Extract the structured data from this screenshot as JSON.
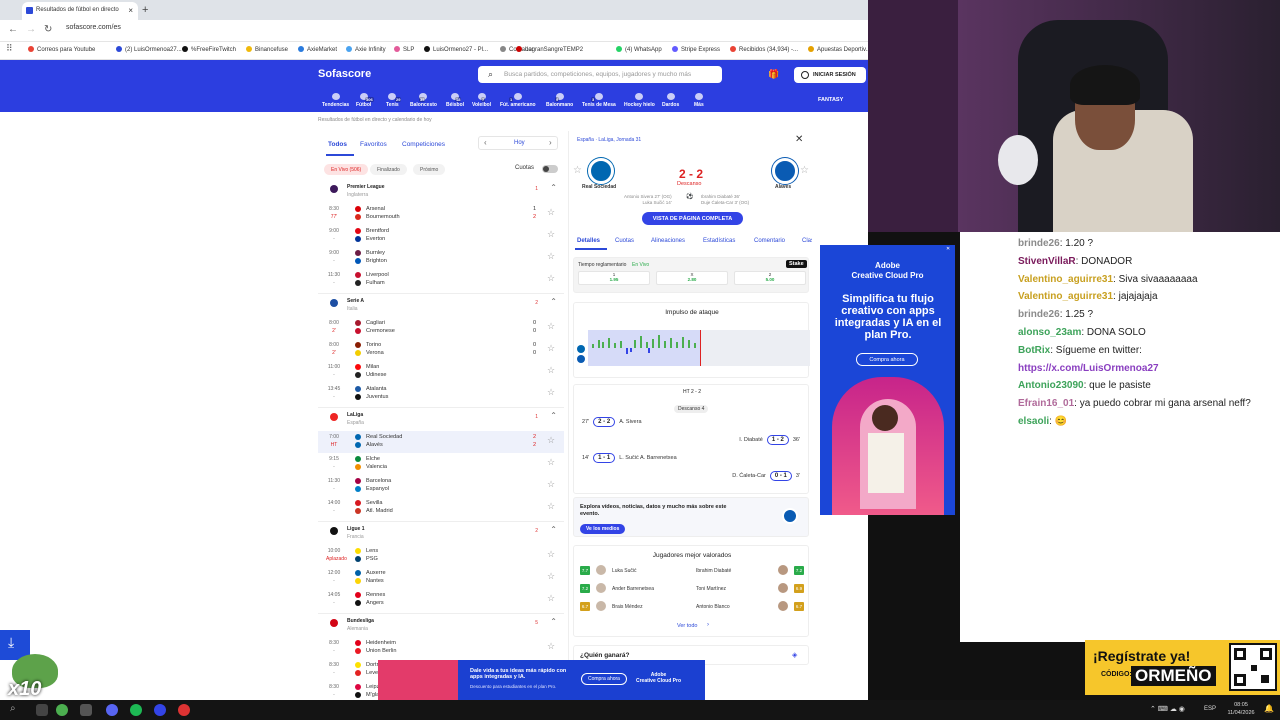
{
  "browser": {
    "tab_title": "Resultados de fútbol en directo",
    "tab_close": "×",
    "new_tab": "+",
    "url": "sofascore.com/es",
    "bookmarks": [
      {
        "label": "Correos para Youtube",
        "color": "#ea4335"
      },
      {
        "label": "(2) LuisOrmenoa27...",
        "color": "#2c49d8"
      },
      {
        "label": "%FreeFireTwitch",
        "color": "#111"
      },
      {
        "label": "Binancefuse",
        "color": "#f0b90b"
      },
      {
        "label": "AxieMarket",
        "color": "#2a7bde"
      },
      {
        "label": "Axie Infinity",
        "color": "#4aa3f0"
      },
      {
        "label": "SLP",
        "color": "#e35b9a"
      },
      {
        "label": "LuisOrmeno27 - Pl...",
        "color": "#111"
      },
      {
        "label": "Contador",
        "color": "#888"
      },
      {
        "label": "LagranSangreTEMP2",
        "color": "#c00"
      },
      {
        "label": "(4) WhatsApp",
        "color": "#25d366"
      },
      {
        "label": "Stripe Express",
        "color": "#635bff"
      },
      {
        "label": "Recibidos (34,934) -...",
        "color": "#ea4335"
      },
      {
        "label": "Apuestas Deportiv...",
        "color": "#e5a100"
      }
    ]
  },
  "sofascore": {
    "logo": "Sofascore",
    "search_placeholder": "Busca partidos, competiciones, equipos, jugadores y mucho más",
    "login": "INICIAR SESIÓN",
    "fantasy": "FANTASY",
    "sports": [
      {
        "label": "Tendencias"
      },
      {
        "label": "Fútbol",
        "badge": "306"
      },
      {
        "label": "Tenis",
        "badge": "29"
      },
      {
        "label": "Baloncesto",
        "badge": "35"
      },
      {
        "label": "Béisbol",
        "badge": "18"
      },
      {
        "label": "Voleibol",
        "badge": "7"
      },
      {
        "label": "Fút. americano",
        "badge": "1"
      },
      {
        "label": "Balonmano",
        "badge": "9"
      },
      {
        "label": "Tenis de Mesa",
        "badge": "3"
      },
      {
        "label": "Hockey hielo"
      },
      {
        "label": "Dardos"
      },
      {
        "label": "Más"
      }
    ],
    "breadcrumb": "Resultados de fútbol en directo y calendario de hoy",
    "left": {
      "tabs": [
        "Todos",
        "Favoritos",
        "Competiciones"
      ],
      "day": "Hoy",
      "filters": [
        "En Vivo (506)",
        "Finalizado",
        "Próximo"
      ],
      "odds_label": "Cuotas",
      "leagues": [
        {
          "name": "Premier League",
          "country": "Inglaterra",
          "count": "1",
          "color": "#3d195b",
          "matches": [
            {
              "time": "8:30",
              "min": "77'",
              "home": "Arsenal",
              "away": "Bournemouth",
              "hs": "1",
              "as": "2",
              "hc": "#db0007",
              "ac": "#da291c"
            },
            {
              "time": "9:00",
              "min": "-",
              "home": "Brentford",
              "away": "Everton",
              "hs": "",
              "as": "",
              "hc": "#e30613",
              "ac": "#003399"
            },
            {
              "time": "9:00",
              "min": "-",
              "home": "Burnley",
              "away": "Brighton",
              "hs": "",
              "as": "",
              "hc": "#6c1d45",
              "ac": "#0057b8"
            },
            {
              "time": "11:30",
              "min": "-",
              "home": "Liverpool",
              "away": "Fulham",
              "hs": "",
              "as": "",
              "hc": "#c8102e",
              "ac": "#222"
            }
          ]
        },
        {
          "name": "Serie A",
          "country": "Italia",
          "count": "2",
          "color": "#1c4ea3",
          "matches": [
            {
              "time": "8:00",
              "min": "2'",
              "home": "Cagliari",
              "away": "Cremonese",
              "hs": "0",
              "as": "0",
              "hc": "#a6192e",
              "ac": "#c8102e"
            },
            {
              "time": "8:00",
              "min": "2'",
              "home": "Torino",
              "away": "Verona",
              "hs": "0",
              "as": "0",
              "hc": "#8a1e03",
              "ac": "#f3cd00"
            },
            {
              "time": "11:00",
              "min": "-",
              "home": "Milan",
              "away": "Udinese",
              "hs": "",
              "as": "",
              "hc": "#fb090b",
              "ac": "#222"
            },
            {
              "time": "13:45",
              "min": "-",
              "home": "Atalanta",
              "away": "Juventus",
              "hs": "",
              "as": "",
              "hc": "#1c5aa6",
              "ac": "#111"
            }
          ]
        },
        {
          "name": "LaLiga",
          "country": "España",
          "count": "1",
          "color": "#ee2523",
          "matches": [
            {
              "time": "7:00",
              "min": "HT",
              "home": "Real Sociedad",
              "away": "Alavés",
              "hs": "2",
              "as": "2",
              "hc": "#0067b1",
              "ac": "#0067b1",
              "sel": true
            },
            {
              "time": "9:15",
              "min": "-",
              "home": "Elche",
              "away": "Valencia",
              "hs": "",
              "as": "",
              "hc": "#0a8a3c",
              "ac": "#f18e00"
            },
            {
              "time": "11:30",
              "min": "-",
              "home": "Barcelona",
              "away": "Espanyol",
              "hs": "",
              "as": "",
              "hc": "#a50044",
              "ac": "#007fc8"
            },
            {
              "time": "14:00",
              "min": "-",
              "home": "Sevilla",
              "away": "Atl. Madrid",
              "hs": "",
              "as": "",
              "hc": "#d71920",
              "ac": "#cb3524"
            }
          ]
        },
        {
          "name": "Ligue 1",
          "country": "Francia",
          "count": "2",
          "color": "#111",
          "matches": [
            {
              "time": "10:00",
              "min": "Aplazado",
              "home": "Lens",
              "away": "PSG",
              "hs": "",
              "as": "",
              "hc": "#fddd00",
              "ac": "#004170"
            },
            {
              "time": "12:00",
              "min": "-",
              "home": "Auxerre",
              "away": "Nantes",
              "hs": "",
              "as": "",
              "hc": "#0061a8",
              "ac": "#fcd405"
            },
            {
              "time": "14:05",
              "min": "-",
              "home": "Rennes",
              "away": "Angers",
              "hs": "",
              "as": "",
              "hc": "#e2001a",
              "ac": "#111"
            }
          ]
        },
        {
          "name": "Bundesliga",
          "country": "Alemania",
          "count": "5",
          "color": "#d20515",
          "matches": [
            {
              "time": "8:30",
              "min": "-",
              "home": "Heidenheim",
              "away": "Union Berlin",
              "hs": "",
              "as": "",
              "hc": "#e2001a",
              "ac": "#eb1923"
            },
            {
              "time": "8:30",
              "min": "-",
              "home": "Dortmund",
              "away": "Leverkusen",
              "hs": "",
              "as": "",
              "hc": "#fde100",
              "ac": "#e32221"
            },
            {
              "time": "8:30",
              "min": "-",
              "home": "Leipzig",
              "away": "M'gladbach",
              "hs": "",
              "as": "",
              "hc": "#dd0741",
              "ac": "#111"
            }
          ]
        }
      ]
    },
    "right": {
      "breadcrumb": "España · LaLiga, Jornada 31",
      "home": "Real Sociedad",
      "away": "Alavés",
      "score": "2 - 2",
      "status": "Descanso",
      "home_scorers": "Antonio Sivera 27' (OG)\nLuka Sučić 14'",
      "away_scorers": "Ibrahim Diabaté 36'\nDuje Ćaleta-Car 3' (OG)",
      "full_page_btn": "VISTA DE PÁGINA COMPLETA",
      "tabs": [
        "Detalles",
        "Cuotas",
        "Alineaciones",
        "Estadísticas",
        "Comentario",
        "Clas"
      ],
      "odds_label": "Tiempo reglamentario",
      "odds_live": "En Vivo",
      "odds_brand": "Stake",
      "odds": [
        {
          "k": "1",
          "v": "1.95"
        },
        {
          "k": "X",
          "v": "2.80"
        },
        {
          "k": "2",
          "v": "5.00"
        }
      ],
      "momentum_title": "Impulso de ataque",
      "ht_label": "HT 2 - 2",
      "descanso_label": "Descanso 4",
      "events": [
        {
          "min": "27'",
          "score": "2 - 2",
          "player": "A. Sivera",
          "side": "left"
        },
        {
          "min": "36'",
          "score": "1 - 2",
          "player": "I. Diabaté",
          "side": "right"
        },
        {
          "min": "14'",
          "score": "1 - 1",
          "player": "L. Sučić  A. Barrenetxea",
          "side": "left"
        },
        {
          "min": "3'",
          "score": "0 - 1",
          "player": "D. Ćaleta-Car",
          "side": "right"
        }
      ],
      "explore_text": "Explora vídeos, noticias, datos y mucho más sobre este evento.",
      "media_btn": "Ve los medios",
      "top_players_title": "Jugadores mejor valorados",
      "top_players": [
        {
          "left": "Luka Sučić",
          "lr": "7.7",
          "lc": "#2aab4a",
          "right": "Ibrahim Diabaté",
          "rr": "7.2",
          "rc": "#2aab4a"
        },
        {
          "left": "Ander Barrenetxea",
          "lr": "7.2",
          "lc": "#2aab4a",
          "right": "Toni Martínez",
          "rr": "6.9",
          "rc": "#d3a01c"
        },
        {
          "left": "Brais Méndez",
          "lr": "6.7",
          "lc": "#d3a01c",
          "right": "Antonio Blanco",
          "rr": "6.7",
          "rc": "#d3a01c"
        }
      ],
      "see_all": "Ver todo",
      "who_wins": "¿Quién ganará?"
    }
  },
  "side_ad": {
    "brand": "Adobe\nCreative Cloud Pro",
    "headline": "Simplifica tu flujo creativo con apps integradas y IA en el plan Pro.",
    "cta": "Compra ahora"
  },
  "bottom_ad": {
    "headline": "Dale vida a tus ideas más rápido con apps integradas y IA.",
    "sub": "Descuento para estudiantes en el plan Pro.",
    "cta": "Compra ahora",
    "brand": "Adobe\nCreative Cloud Pro"
  },
  "chat": [
    {
      "user": "brinde26",
      "msg": ": 1.20 ?",
      "color": "#8a8a8a"
    },
    {
      "user": "StivenVillaR",
      "msg": ": DONADOR",
      "color": "#7a1a5b"
    },
    {
      "user": "Valentino_aguirre31",
      "msg": ": Siva sivaaaaaaaa",
      "color": "#c8a020"
    },
    {
      "user": "Valentino_aguirre31",
      "msg": ": jajajajaja",
      "color": "#c8a020"
    },
    {
      "user": "brinde26",
      "msg": ": 1.25 ?",
      "color": "#8a8a8a"
    },
    {
      "user": "alonso_23am",
      "msg": ": DONA SOLO",
      "color": "#3da35a"
    },
    {
      "user": "BotRix",
      "msg": ": Sígueme en twitter:",
      "color": "#3da35a"
    },
    {
      "user": "",
      "msg": "https://x.com/LuisOrmenoa27",
      "color": "#8a3fc0"
    },
    {
      "user": "Antonio23090",
      "msg": ": que le pasiste",
      "color": "#3da35a"
    },
    {
      "user": "Efrain16_01",
      "msg": ": ya puedo cobrar mi gana arsenal neff?",
      "color": "#b06a9a"
    },
    {
      "user": "elsaoli",
      "msg": ": 😊",
      "color": "#3da35a"
    }
  ],
  "promo": {
    "title": "¡Regístrate ya!",
    "code_label": "CÓDIGO:",
    "code": "ORMEÑO"
  },
  "overlay": {
    "multiplier": "x10"
  },
  "taskbar": {
    "lang": "ESP",
    "time": "08:05",
    "date": "11/04/2026"
  }
}
